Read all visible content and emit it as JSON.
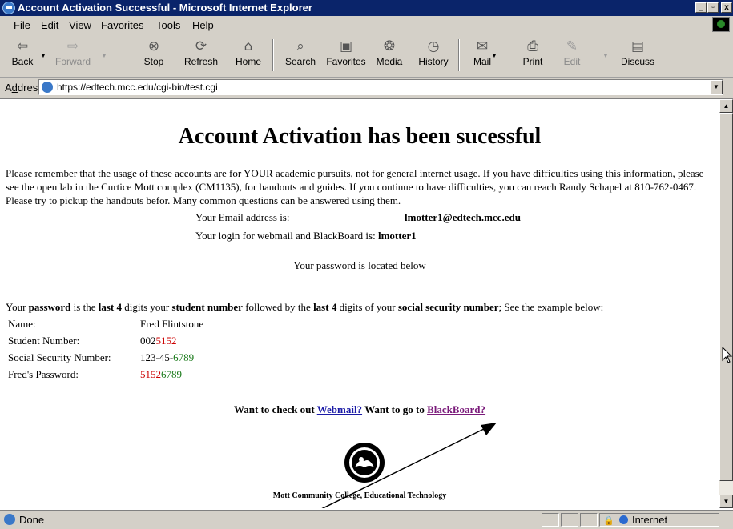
{
  "window": {
    "title": "Account Activation Successful - Microsoft Internet Explorer",
    "controls": [
      "_",
      "▫",
      "x"
    ]
  },
  "menu": [
    {
      "label": "File",
      "u": "F",
      "rest": "ile"
    },
    {
      "label": "Edit",
      "u": "E",
      "rest": "dit"
    },
    {
      "label": "View",
      "u": "V",
      "rest": "iew"
    },
    {
      "label": "Favorites",
      "u": "a",
      "pre": "F",
      "rest": "vorites"
    },
    {
      "label": "Tools",
      "u": "T",
      "rest": "ools"
    },
    {
      "label": "Help",
      "u": "H",
      "rest": "elp"
    }
  ],
  "toolbar": {
    "back": "Back",
    "forward": "Forward",
    "stop": "Stop",
    "refresh": "Refresh",
    "home": "Home",
    "search": "Search",
    "favorites": "Favorites",
    "media": "Media",
    "history": "History",
    "mail": "Mail",
    "print": "Print",
    "edit": "Edit",
    "discuss": "Discuss"
  },
  "address": {
    "label_u": "d",
    "label_pre": "A",
    "label_rest": "dress",
    "url": "https://edtech.mcc.edu/cgi-bin/test.cgi"
  },
  "page": {
    "heading": "Account Activation has been sucessful",
    "intro": "Please remember that the usage of these accounts are for YOUR academic pursuits, not for general internet usage. If you have difficulties using this information, please see the open lab in the Curtice Mott complex (CM1135), for handouts and guides. If you continue to have difficulties, you can reach Randy Schapel at 810-762-0467. Please try to pickup the handouts befor. Many common questions can be answered using them.",
    "email_label": "Your Email address is:",
    "email_value": "lmotter1@edtech.mcc.edu",
    "login_label": "Your login for webmail and BlackBoard is:",
    "login_value": "lmotter1",
    "password_note": "Your password is located below",
    "pw_rule": {
      "t1": "Your ",
      "b1": "password",
      "t2": " is the ",
      "b2": "last 4",
      "t3": " digits your ",
      "b3": "student number",
      "t4": " followed by the ",
      "b4": "last 4",
      "t5": " digits of your ",
      "b5": "social security number",
      "t6": "; See the example below:"
    },
    "example": {
      "name_label": "Name:",
      "name_value": "Fred Flintstone",
      "student_label": "Student Number:",
      "student_plain": "002",
      "student_red": "5152",
      "ssn_label": "Social Security Number:",
      "ssn_plain": "123-45-",
      "ssn_green": "6789",
      "pw_label": "Fred's Password:",
      "pw_red": "5152",
      "pw_green": "6789"
    },
    "links": {
      "t1": "Want to check out ",
      "webmail": "Webmail?",
      "t2": " Want to go to ",
      "blackboard": "BlackBoard?"
    },
    "footer": "Mott Community College, Educational Technology"
  },
  "status": {
    "text": "Done",
    "zone": "Internet"
  }
}
